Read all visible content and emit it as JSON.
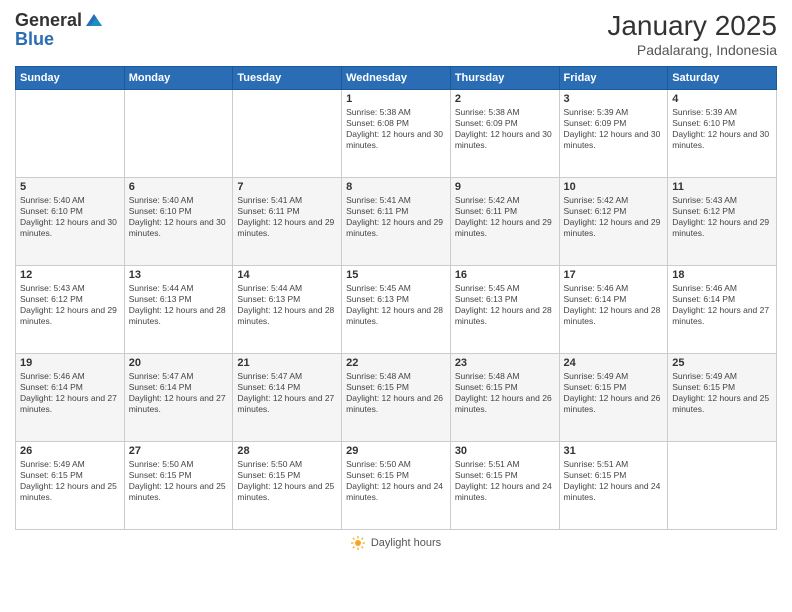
{
  "logo": {
    "general": "General",
    "blue": "Blue"
  },
  "title": "January 2025",
  "location": "Padalarang, Indonesia",
  "days_of_week": [
    "Sunday",
    "Monday",
    "Tuesday",
    "Wednesday",
    "Thursday",
    "Friday",
    "Saturday"
  ],
  "weeks": [
    [
      {
        "day": "",
        "info": ""
      },
      {
        "day": "",
        "info": ""
      },
      {
        "day": "",
        "info": ""
      },
      {
        "day": "1",
        "info": "Sunrise: 5:38 AM\nSunset: 6:08 PM\nDaylight: 12 hours and 30 minutes."
      },
      {
        "day": "2",
        "info": "Sunrise: 5:38 AM\nSunset: 6:09 PM\nDaylight: 12 hours and 30 minutes."
      },
      {
        "day": "3",
        "info": "Sunrise: 5:39 AM\nSunset: 6:09 PM\nDaylight: 12 hours and 30 minutes."
      },
      {
        "day": "4",
        "info": "Sunrise: 5:39 AM\nSunset: 6:10 PM\nDaylight: 12 hours and 30 minutes."
      }
    ],
    [
      {
        "day": "5",
        "info": "Sunrise: 5:40 AM\nSunset: 6:10 PM\nDaylight: 12 hours and 30 minutes."
      },
      {
        "day": "6",
        "info": "Sunrise: 5:40 AM\nSunset: 6:10 PM\nDaylight: 12 hours and 30 minutes."
      },
      {
        "day": "7",
        "info": "Sunrise: 5:41 AM\nSunset: 6:11 PM\nDaylight: 12 hours and 29 minutes."
      },
      {
        "day": "8",
        "info": "Sunrise: 5:41 AM\nSunset: 6:11 PM\nDaylight: 12 hours and 29 minutes."
      },
      {
        "day": "9",
        "info": "Sunrise: 5:42 AM\nSunset: 6:11 PM\nDaylight: 12 hours and 29 minutes."
      },
      {
        "day": "10",
        "info": "Sunrise: 5:42 AM\nSunset: 6:12 PM\nDaylight: 12 hours and 29 minutes."
      },
      {
        "day": "11",
        "info": "Sunrise: 5:43 AM\nSunset: 6:12 PM\nDaylight: 12 hours and 29 minutes."
      }
    ],
    [
      {
        "day": "12",
        "info": "Sunrise: 5:43 AM\nSunset: 6:12 PM\nDaylight: 12 hours and 29 minutes."
      },
      {
        "day": "13",
        "info": "Sunrise: 5:44 AM\nSunset: 6:13 PM\nDaylight: 12 hours and 28 minutes."
      },
      {
        "day": "14",
        "info": "Sunrise: 5:44 AM\nSunset: 6:13 PM\nDaylight: 12 hours and 28 minutes."
      },
      {
        "day": "15",
        "info": "Sunrise: 5:45 AM\nSunset: 6:13 PM\nDaylight: 12 hours and 28 minutes."
      },
      {
        "day": "16",
        "info": "Sunrise: 5:45 AM\nSunset: 6:13 PM\nDaylight: 12 hours and 28 minutes."
      },
      {
        "day": "17",
        "info": "Sunrise: 5:46 AM\nSunset: 6:14 PM\nDaylight: 12 hours and 28 minutes."
      },
      {
        "day": "18",
        "info": "Sunrise: 5:46 AM\nSunset: 6:14 PM\nDaylight: 12 hours and 27 minutes."
      }
    ],
    [
      {
        "day": "19",
        "info": "Sunrise: 5:46 AM\nSunset: 6:14 PM\nDaylight: 12 hours and 27 minutes."
      },
      {
        "day": "20",
        "info": "Sunrise: 5:47 AM\nSunset: 6:14 PM\nDaylight: 12 hours and 27 minutes."
      },
      {
        "day": "21",
        "info": "Sunrise: 5:47 AM\nSunset: 6:14 PM\nDaylight: 12 hours and 27 minutes."
      },
      {
        "day": "22",
        "info": "Sunrise: 5:48 AM\nSunset: 6:15 PM\nDaylight: 12 hours and 26 minutes."
      },
      {
        "day": "23",
        "info": "Sunrise: 5:48 AM\nSunset: 6:15 PM\nDaylight: 12 hours and 26 minutes."
      },
      {
        "day": "24",
        "info": "Sunrise: 5:49 AM\nSunset: 6:15 PM\nDaylight: 12 hours and 26 minutes."
      },
      {
        "day": "25",
        "info": "Sunrise: 5:49 AM\nSunset: 6:15 PM\nDaylight: 12 hours and 25 minutes."
      }
    ],
    [
      {
        "day": "26",
        "info": "Sunrise: 5:49 AM\nSunset: 6:15 PM\nDaylight: 12 hours and 25 minutes."
      },
      {
        "day": "27",
        "info": "Sunrise: 5:50 AM\nSunset: 6:15 PM\nDaylight: 12 hours and 25 minutes."
      },
      {
        "day": "28",
        "info": "Sunrise: 5:50 AM\nSunset: 6:15 PM\nDaylight: 12 hours and 25 minutes."
      },
      {
        "day": "29",
        "info": "Sunrise: 5:50 AM\nSunset: 6:15 PM\nDaylight: 12 hours and 24 minutes."
      },
      {
        "day": "30",
        "info": "Sunrise: 5:51 AM\nSunset: 6:15 PM\nDaylight: 12 hours and 24 minutes."
      },
      {
        "day": "31",
        "info": "Sunrise: 5:51 AM\nSunset: 6:15 PM\nDaylight: 12 hours and 24 minutes."
      },
      {
        "day": "",
        "info": ""
      }
    ]
  ],
  "footer": {
    "daylight_label": "Daylight hours"
  }
}
